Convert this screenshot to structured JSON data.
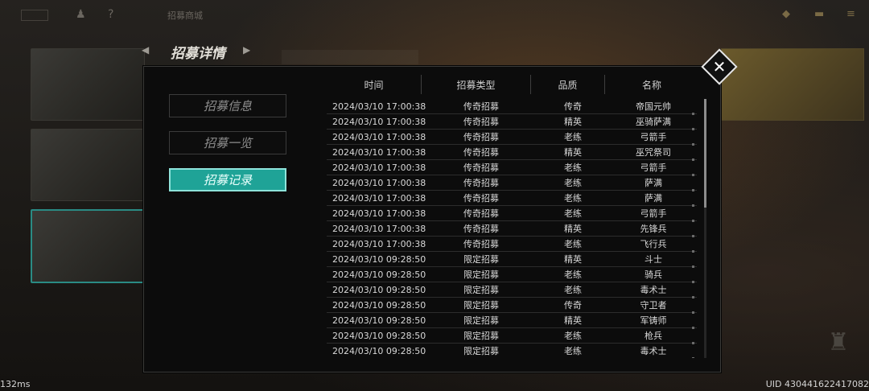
{
  "topbar": {
    "label": "招募商城"
  },
  "title": "招募详情",
  "tabs": [
    {
      "label": "招募信息",
      "active": false
    },
    {
      "label": "招募一览",
      "active": false
    },
    {
      "label": "招募记录",
      "active": true
    }
  ],
  "table": {
    "headers": [
      "时间",
      "招募类型",
      "品质",
      "名称"
    ],
    "rows": [
      [
        "2024/03/10 17:00:38",
        "传奇招募",
        "传奇",
        "帝国元帅"
      ],
      [
        "2024/03/10 17:00:38",
        "传奇招募",
        "精英",
        "巫骑萨满"
      ],
      [
        "2024/03/10 17:00:38",
        "传奇招募",
        "老练",
        "弓箭手"
      ],
      [
        "2024/03/10 17:00:38",
        "传奇招募",
        "精英",
        "巫咒祭司"
      ],
      [
        "2024/03/10 17:00:38",
        "传奇招募",
        "老练",
        "弓箭手"
      ],
      [
        "2024/03/10 17:00:38",
        "传奇招募",
        "老练",
        "萨满"
      ],
      [
        "2024/03/10 17:00:38",
        "传奇招募",
        "老练",
        "萨满"
      ],
      [
        "2024/03/10 17:00:38",
        "传奇招募",
        "老练",
        "弓箭手"
      ],
      [
        "2024/03/10 17:00:38",
        "传奇招募",
        "精英",
        "先锋兵"
      ],
      [
        "2024/03/10 17:00:38",
        "传奇招募",
        "老练",
        "飞行兵"
      ],
      [
        "2024/03/10 09:28:50",
        "限定招募",
        "精英",
        "斗士"
      ],
      [
        "2024/03/10 09:28:50",
        "限定招募",
        "老练",
        "骑兵"
      ],
      [
        "2024/03/10 09:28:50",
        "限定招募",
        "老练",
        "毒术士"
      ],
      [
        "2024/03/10 09:28:50",
        "限定招募",
        "传奇",
        "守卫者"
      ],
      [
        "2024/03/10 09:28:50",
        "限定招募",
        "精英",
        "军铸师"
      ],
      [
        "2024/03/10 09:28:50",
        "限定招募",
        "老练",
        "枪兵"
      ],
      [
        "2024/03/10 09:28:50",
        "限定招募",
        "老练",
        "毒术士"
      ]
    ]
  },
  "footer": {
    "latency": "132ms",
    "uid": "UID 430441622417082"
  },
  "colors": {
    "accent": "#1fa397",
    "panel_bg": "#0c0c0c"
  }
}
